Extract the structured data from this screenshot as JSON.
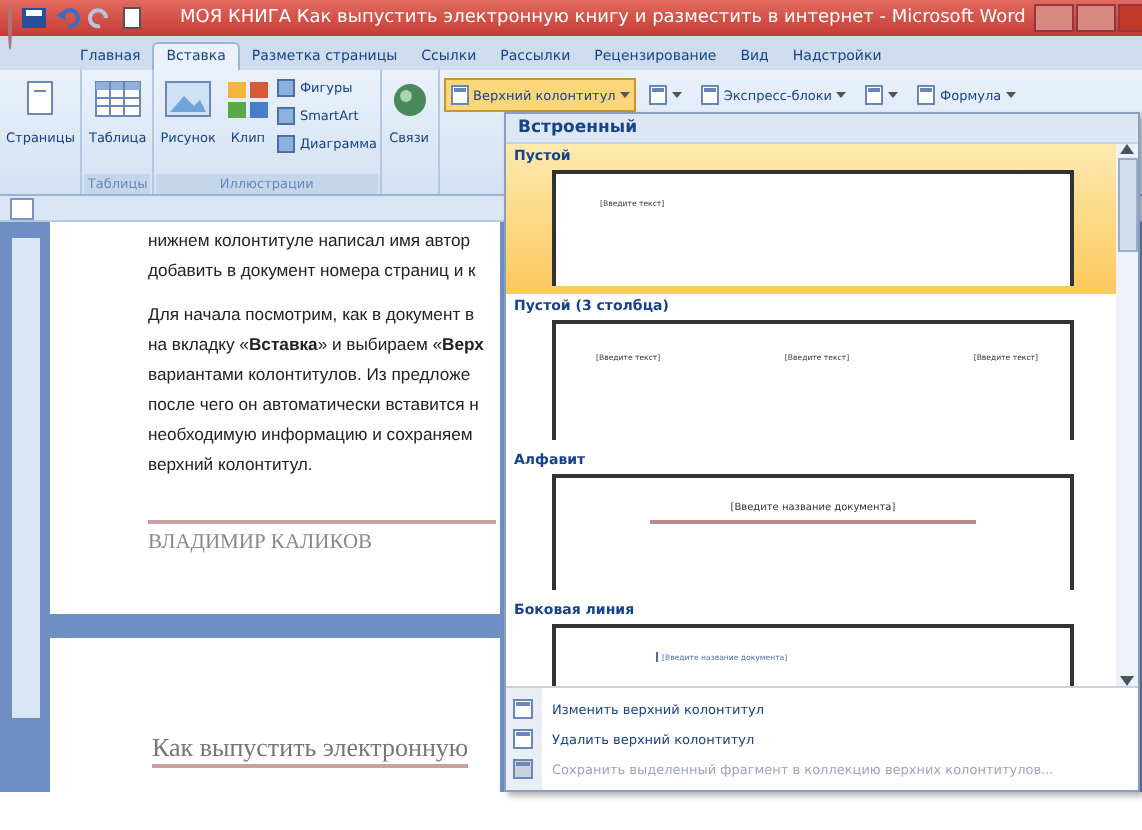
{
  "window": {
    "title": "МОЯ КНИГА Как выпустить электронную книгу и разместить в интернет - Microsoft Word"
  },
  "tabs": [
    {
      "label": "Главная",
      "selected": false
    },
    {
      "label": "Вставка",
      "selected": true
    },
    {
      "label": "Разметка страницы",
      "selected": false
    },
    {
      "label": "Ссылки",
      "selected": false
    },
    {
      "label": "Рассылки",
      "selected": false
    },
    {
      "label": "Рецензирование",
      "selected": false
    },
    {
      "label": "Вид",
      "selected": false
    },
    {
      "label": "Надстройки",
      "selected": false
    }
  ],
  "ribbon": {
    "groups": [
      {
        "buttons": [
          {
            "kind": "page",
            "label": "Страницы"
          }
        ]
      },
      {
        "label": "Таблицы",
        "buttons": [
          {
            "kind": "table",
            "label": "Таблица"
          }
        ]
      },
      {
        "label": "Иллюстрации",
        "buttons": [
          {
            "kind": "picture",
            "label": "Рисунок"
          },
          {
            "kind": "clip",
            "label": "Клип"
          },
          {
            "kind": "small",
            "label": "Фигуры"
          },
          {
            "kind": "small",
            "label": "SmartArt"
          },
          {
            "kind": "small",
            "label": "Диаграмма"
          }
        ]
      },
      {
        "buttons": [
          {
            "kind": "links",
            "label": "Связи"
          }
        ]
      }
    ],
    "header_row": [
      {
        "label": "Верхний колонтитул",
        "pressed": true
      },
      {
        "pressed": false
      },
      {
        "label": "Экспресс-блоки",
        "pressed": false
      },
      {
        "pressed": false
      },
      {
        "label": "Формула",
        "pressed": false
      }
    ]
  },
  "document": {
    "paragraphs": [
      [
        "нижнем колонтитуле написал имя автор",
        "добавить в документ номера страниц и к"
      ],
      [
        "Для начала посмотрим, как в документ в",
        "на вкладку «**Вставка**» и выбираем «**Верх**",
        "вариантами колонтитулов. Из предложе",
        "после чего он автоматически вставится н",
        "необходимую информацию и сохраняем",
        "верхний колонтитул."
      ]
    ],
    "author": "ВЛАДИМИР КАЛИКОВ",
    "next_page_heading": "Как выпустить электронную"
  },
  "dropdown": {
    "section": "Встроенный",
    "items": [
      {
        "label": "Пустой",
        "kind": "one",
        "selected": true,
        "preview": [
          "[Введите текст]"
        ]
      },
      {
        "label": "Пустой (3 столбца)",
        "kind": "three",
        "selected": false,
        "preview": [
          "[Введите текст]",
          "[Введите текст]",
          "[Введите текст]"
        ]
      },
      {
        "label": "Алфавит",
        "kind": "title",
        "selected": false,
        "preview": [
          "[Введите название документа]"
        ]
      },
      {
        "label": "Боковая линия",
        "kind": "side",
        "selected": false,
        "preview": [
          "[Введите название документа]"
        ]
      }
    ],
    "commands": [
      {
        "label": "Изменить верхний колонтитул",
        "disabled": false
      },
      {
        "label": "Удалить верхний колонтитул",
        "disabled": false
      },
      {
        "label": "Сохранить выделенный фрагмент в коллекцию верхних колонтитулов...",
        "disabled": true
      }
    ]
  }
}
